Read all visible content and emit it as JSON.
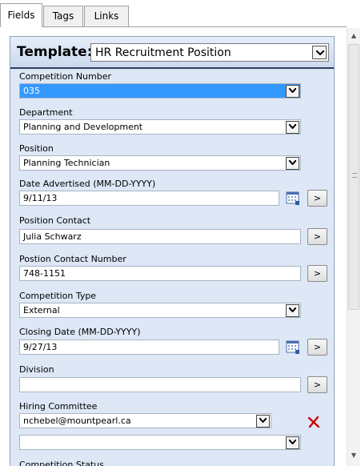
{
  "tabs": [
    {
      "label": "Fields",
      "active": true
    },
    {
      "label": "Tags",
      "active": false
    },
    {
      "label": "Links",
      "active": false
    }
  ],
  "template": {
    "label": "Template:",
    "value": "HR Recruitment Position"
  },
  "fields": {
    "competition_number": {
      "label": "Competition Number",
      "value": "035"
    },
    "department": {
      "label": "Department",
      "value": "Planning and Development"
    },
    "position": {
      "label": "Position",
      "value": "Planning Technician"
    },
    "date_advertised": {
      "label": "Date Advertised (MM-DD-YYYY)",
      "value": "9/11/13",
      "go": ">"
    },
    "position_contact": {
      "label": "Position Contact",
      "value": "Julia Schwarz",
      "go": ">"
    },
    "contact_number": {
      "label": "Postion Contact Number",
      "value": "748-1151",
      "go": ">"
    },
    "competition_type": {
      "label": "Competition Type",
      "value": "External"
    },
    "closing_date": {
      "label": "Closing Date (MM-DD-YYYY)",
      "value": "9/27/13",
      "go": ">"
    },
    "division": {
      "label": "Division",
      "value": "",
      "go": ">"
    },
    "hiring_committee": {
      "label": "Hiring Committee",
      "values": [
        "nchebel@mountpearl.ca",
        ""
      ]
    },
    "competition_status": {
      "label": "Competition Status"
    }
  },
  "colors": {
    "selection": "#3399ff",
    "panel_bg": "#dde7f5",
    "header_rule": "#2d3f63",
    "remove_icon": "#cc0000"
  },
  "icons": {
    "calendar": "calendar-icon",
    "remove": "remove-x-icon",
    "dropdown": "chevron-down-icon"
  }
}
